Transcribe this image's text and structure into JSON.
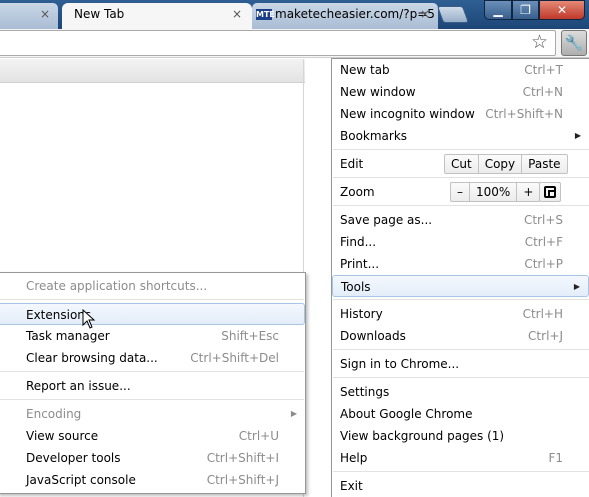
{
  "tabs": [
    {
      "label": "",
      "close": "×"
    },
    {
      "label": "New Tab",
      "close": "×"
    },
    {
      "label": "maketecheasier.com/?p=5",
      "favicon": "MTE",
      "close": "×"
    }
  ],
  "window": {
    "minimize": "▁",
    "maximize": "❐",
    "close": "✕"
  },
  "toolbar": {
    "star_icon": "☆",
    "wrench_icon": "🔧"
  },
  "main_menu": {
    "new_tab": {
      "label": "New tab",
      "shortcut": "Ctrl+T"
    },
    "new_window": {
      "label": "New window",
      "shortcut": "Ctrl+N"
    },
    "new_incognito": {
      "label": "New incognito window",
      "shortcut": "Ctrl+Shift+N"
    },
    "bookmarks": {
      "label": "Bookmarks"
    },
    "edit": {
      "label": "Edit",
      "cut": "Cut",
      "copy": "Copy",
      "paste": "Paste"
    },
    "zoom": {
      "label": "Zoom",
      "minus": "–",
      "level": "100%",
      "plus": "+"
    },
    "save_page": {
      "label": "Save page as...",
      "shortcut": "Ctrl+S"
    },
    "find": {
      "label": "Find...",
      "shortcut": "Ctrl+F"
    },
    "print": {
      "label": "Print...",
      "shortcut": "Ctrl+P"
    },
    "tools": {
      "label": "Tools"
    },
    "history": {
      "label": "History",
      "shortcut": "Ctrl+H"
    },
    "downloads": {
      "label": "Downloads",
      "shortcut": "Ctrl+J"
    },
    "sign_in": {
      "label": "Sign in to Chrome..."
    },
    "settings": {
      "label": "Settings"
    },
    "about": {
      "label": "About Google Chrome"
    },
    "bg_pages": {
      "label": "View background pages (1)"
    },
    "help": {
      "label": "Help",
      "shortcut": "F1"
    },
    "exit": {
      "label": "Exit"
    }
  },
  "tools_menu": {
    "create_shortcuts": {
      "label": "Create application shortcuts..."
    },
    "extensions": {
      "label": "Extensions"
    },
    "task_manager": {
      "label": "Task manager",
      "shortcut": "Shift+Esc"
    },
    "clear_data": {
      "label": "Clear browsing data...",
      "shortcut": "Ctrl+Shift+Del"
    },
    "report_issue": {
      "label": "Report an issue..."
    },
    "encoding": {
      "label": "Encoding"
    },
    "view_source": {
      "label": "View source",
      "shortcut": "Ctrl+U"
    },
    "dev_tools": {
      "label": "Developer tools",
      "shortcut": "Ctrl+Shift+I"
    },
    "js_console": {
      "label": "JavaScript console",
      "shortcut": "Ctrl+Shift+J"
    }
  },
  "colors": {
    "titlebar": "#2f5f93",
    "highlight_border": "#a8c5e6",
    "disabled_text": "#8c8c8c"
  }
}
